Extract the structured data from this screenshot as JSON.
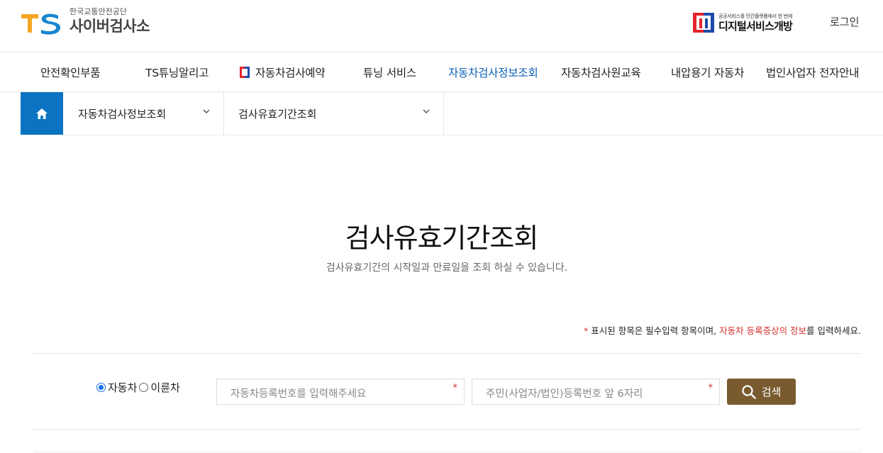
{
  "header": {
    "logo_sub": "한국교통안전공단",
    "logo_main": "사이버검사소",
    "digital_small": "공공서비스를 민간플랫폼에서 한 번에",
    "digital_big": "디지털서비스개방",
    "login": "로그인"
  },
  "gnb": {
    "items": [
      {
        "label": "안전확인부품"
      },
      {
        "label": "TS튜닝알리고"
      },
      {
        "label": "자동차검사예약"
      },
      {
        "label": "튜닝 서비스"
      },
      {
        "label": "자동차검사정보조회"
      },
      {
        "label": "자동차검사원교육"
      },
      {
        "label": "내압용기 자동차"
      },
      {
        "label": "법인사업자 전자안내"
      }
    ],
    "active_color": "#0b5fb4"
  },
  "breadcrumb": {
    "level1": "자동차검사정보조회",
    "level2": "검사유효기간조회"
  },
  "page": {
    "title": "검사유효기간조회",
    "description": "검사유효기간의 시작일과 만료일을 조회 하실 수 있습니다."
  },
  "notice": {
    "star": "*",
    "part1": " 표시된 항목은 필수입력 항목이며, ",
    "highlight": "자동차 등록증상의 정보",
    "part2": "를 입력하세요."
  },
  "form": {
    "radio_car": "자동차",
    "radio_bike": "이륜차",
    "selected": "자동차",
    "plate_placeholder": "자동차등록번호를 입력해주세요",
    "id_placeholder": "주민(사업자/법인)등록번호 앞 6자리",
    "required_mark": "*",
    "search_button": "검색"
  },
  "colors": {
    "brand_blue": "#0a74c2",
    "button_brown": "#7a5b30",
    "required_red": "#d0312d"
  }
}
